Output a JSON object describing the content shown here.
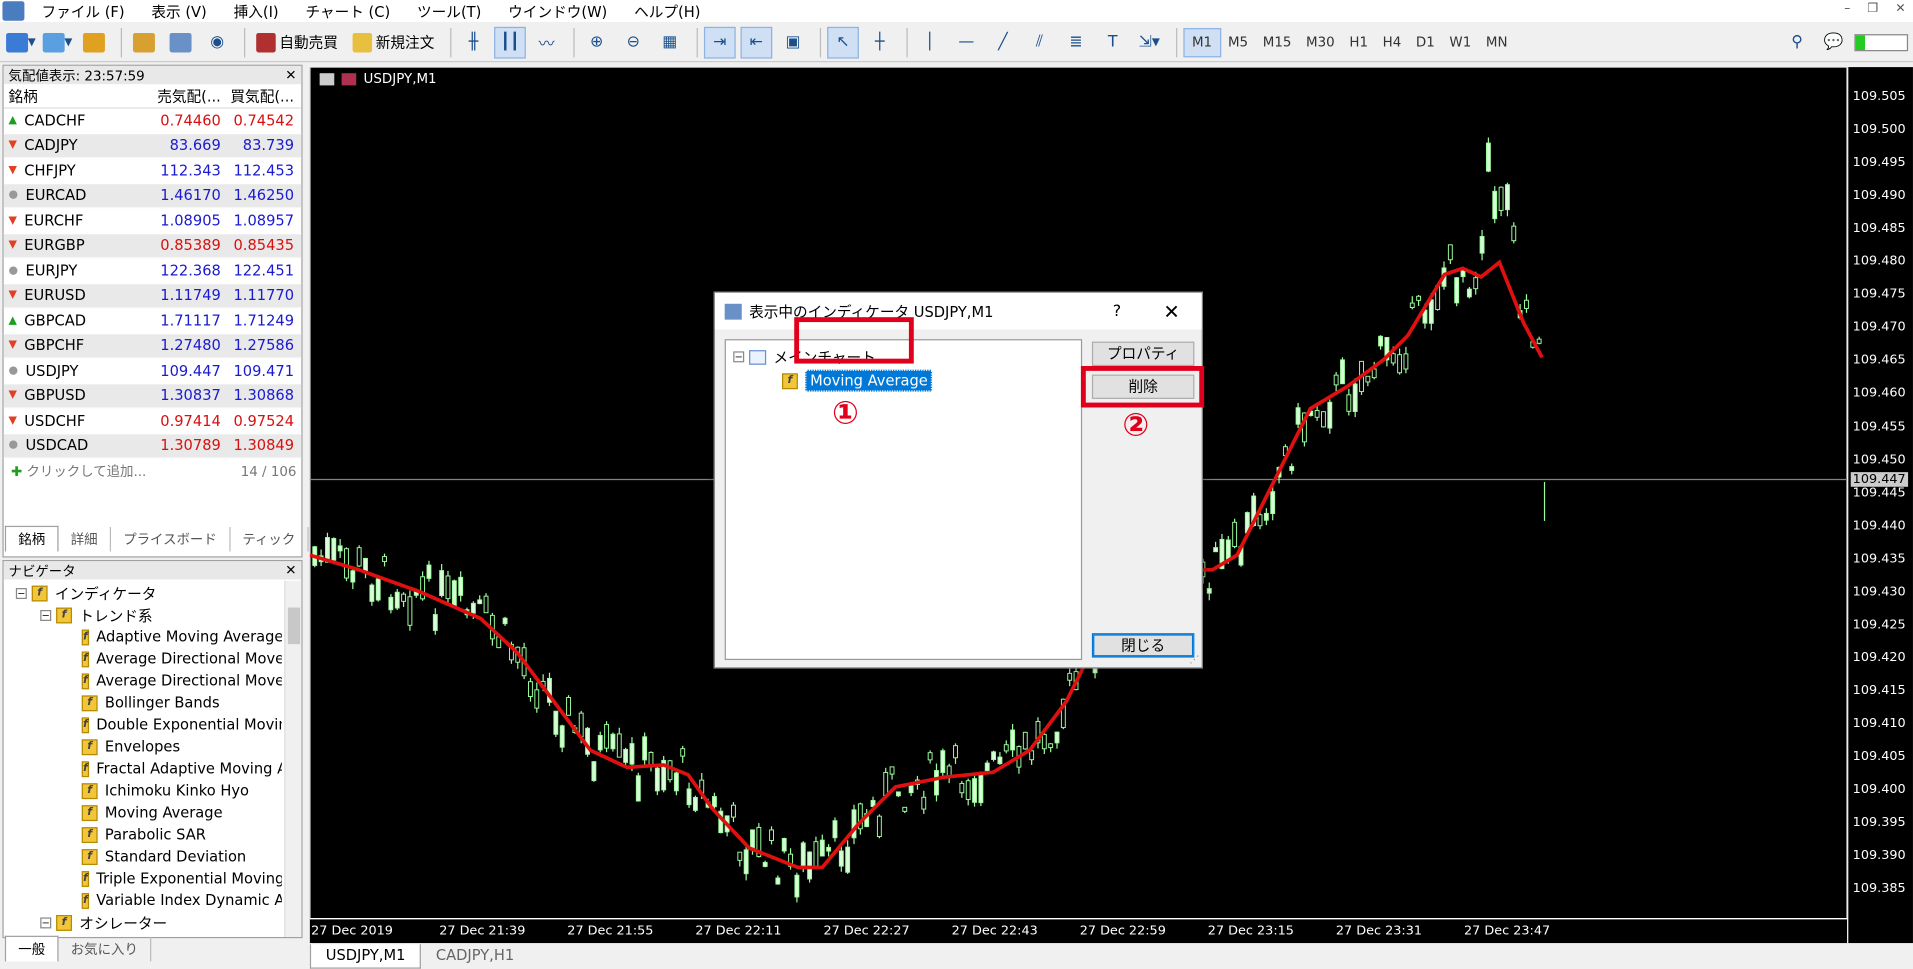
{
  "menu": [
    "ファイル (F)",
    "表示 (V)",
    "挿入(I)",
    "チャート (C)",
    "ツール(T)",
    "ウインドウ(W)",
    "ヘルプ(H)"
  ],
  "toolbar": {
    "autotrade": "自動売買",
    "neworder": "新規注文",
    "timeframes": [
      "M1",
      "M5",
      "M15",
      "M30",
      "H1",
      "H4",
      "D1",
      "W1",
      "MN"
    ],
    "active_tf": "M1"
  },
  "market_watch": {
    "title": "気配値表示: 23:57:59",
    "headers": [
      "銘柄",
      "売気配(...",
      "買気配(..."
    ],
    "rows": [
      {
        "sym": "CADCHF",
        "bid": "0.74460",
        "ask": "0.74542",
        "dir": "up",
        "color": "red"
      },
      {
        "sym": "CADJPY",
        "bid": "83.669",
        "ask": "83.739",
        "dir": "dn",
        "color": "blue"
      },
      {
        "sym": "CHFJPY",
        "bid": "112.343",
        "ask": "112.453",
        "dir": "dn",
        "color": "blue"
      },
      {
        "sym": "EURCAD",
        "bid": "1.46170",
        "ask": "1.46250",
        "dir": "nt",
        "color": "blue"
      },
      {
        "sym": "EURCHF",
        "bid": "1.08905",
        "ask": "1.08957",
        "dir": "dn",
        "color": "blue"
      },
      {
        "sym": "EURGBP",
        "bid": "0.85389",
        "ask": "0.85435",
        "dir": "dn",
        "color": "red"
      },
      {
        "sym": "EURJPY",
        "bid": "122.368",
        "ask": "122.451",
        "dir": "nt",
        "color": "blue"
      },
      {
        "sym": "EURUSD",
        "bid": "1.11749",
        "ask": "1.11770",
        "dir": "dn",
        "color": "blue"
      },
      {
        "sym": "GBPCAD",
        "bid": "1.71117",
        "ask": "1.71249",
        "dir": "up",
        "color": "blue"
      },
      {
        "sym": "GBPCHF",
        "bid": "1.27480",
        "ask": "1.27586",
        "dir": "dn",
        "color": "blue"
      },
      {
        "sym": "USDJPY",
        "bid": "109.447",
        "ask": "109.471",
        "dir": "nt",
        "color": "blue"
      },
      {
        "sym": "GBPUSD",
        "bid": "1.30837",
        "ask": "1.30868",
        "dir": "dn",
        "color": "blue"
      },
      {
        "sym": "USDCHF",
        "bid": "0.97414",
        "ask": "0.97524",
        "dir": "dn",
        "color": "red"
      },
      {
        "sym": "USDCAD",
        "bid": "1.30789",
        "ask": "1.30849",
        "dir": "nt",
        "color": "red"
      }
    ],
    "add_label": "クリックして追加...",
    "count": "14 / 106",
    "tabs": [
      "銘柄",
      "詳細",
      "プライスボード",
      "ティック"
    ]
  },
  "navigator": {
    "title": "ナビゲータ",
    "root": "インディケータ",
    "group": "トレンド系",
    "items": [
      "Adaptive Moving Average",
      "Average Directional Movement",
      "Average Directional Movement",
      "Bollinger Bands",
      "Double Exponential Moving",
      "Envelopes",
      "Fractal Adaptive Moving Average",
      "Ichimoku Kinko Hyo",
      "Moving Average",
      "Parabolic SAR",
      "Standard Deviation",
      "Triple Exponential Moving",
      "Variable Index Dynamic Average"
    ],
    "group2": "オシレーター",
    "tabs": [
      "一般",
      "お気に入り"
    ]
  },
  "chart": {
    "title": "USDJPY,M1",
    "y_labels": [
      "109.505",
      "109.500",
      "109.495",
      "109.490",
      "109.485",
      "109.480",
      "109.475",
      "109.470",
      "109.465",
      "109.460",
      "109.455",
      "109.450",
      "109.445",
      "109.440",
      "109.435",
      "109.430",
      "109.425",
      "109.420",
      "109.415",
      "109.410",
      "109.405",
      "109.400",
      "109.395",
      "109.390",
      "109.385"
    ],
    "x_labels": [
      "27 Dec 2019",
      "27 Dec 21:39",
      "27 Dec 21:55",
      "27 Dec 22:11",
      "27 Dec 22:27",
      "27 Dec 22:43",
      "27 Dec 22:59",
      "27 Dec 23:15",
      "27 Dec 23:31",
      "27 Dec 23:47"
    ],
    "price": "109.447",
    "tabs": [
      "USDJPY,M1",
      "CADJPY,H1"
    ]
  },
  "dialog": {
    "title": "表示中のインディケータ USDJPY,M1",
    "help": "?",
    "close_x": "✕",
    "tree_root": "メインチャート",
    "tree_child": "Moving Average",
    "btn_props": "プロパティ",
    "btn_delete": "削除",
    "btn_close": "閉じる",
    "mark1": "①",
    "mark2": "②"
  }
}
